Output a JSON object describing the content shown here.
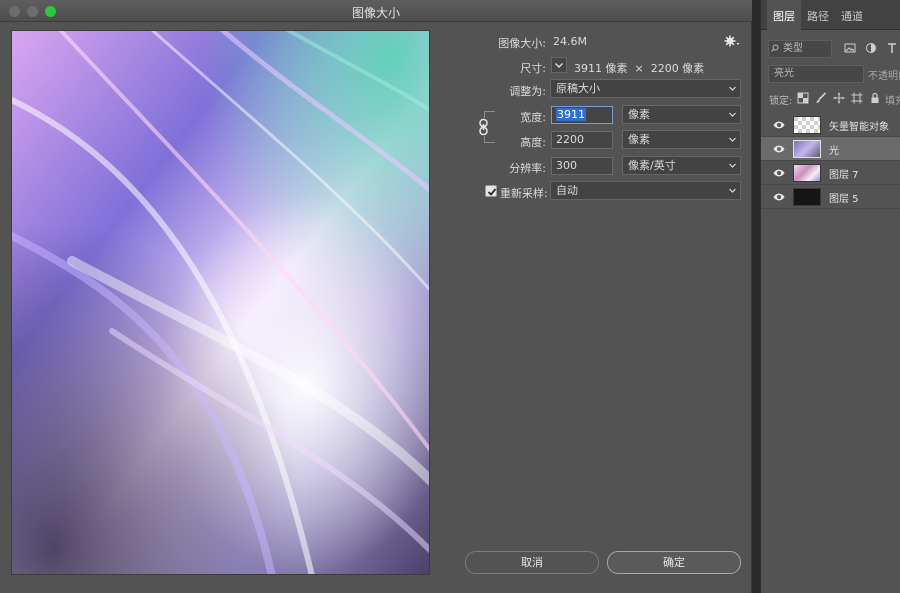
{
  "dialog": {
    "title": "图像大小",
    "image_size_label": "图像大小:",
    "image_size_value": "24.6M",
    "dimensions_label": "尺寸:",
    "dimensions_value": "3911 像素  ×  2200 像素",
    "fit_to_label": "调整为:",
    "fit_to_value": "原稿大小",
    "width_label": "宽度:",
    "width_value": "3911",
    "width_unit": "像素",
    "height_label": "高度:",
    "height_value": "2200",
    "height_unit": "像素",
    "resolution_label": "分辨率:",
    "resolution_value": "300",
    "resolution_unit": "像素/英寸",
    "resample_label": "重新采样:",
    "resample_checked": true,
    "resample_value": "自动",
    "cancel_label": "取消",
    "ok_label": "确定",
    "icons": [
      "gear-icon",
      "chain-link-icon",
      "checkmark-icon",
      "chevron-down-icon"
    ]
  },
  "layers_panel": {
    "tabs": [
      "图层",
      "路径",
      "通道"
    ],
    "active_tab": "图层",
    "kind_filter": "类型",
    "blend_mode": "亮光",
    "opacity_label": "不透明度",
    "lock_label": "锁定:",
    "fill_label": "填充",
    "layers": [
      {
        "name": "矢量智能对象",
        "visible": true,
        "selected": false
      },
      {
        "name": "光",
        "visible": true,
        "selected": true
      },
      {
        "name": "图层 7",
        "visible": true,
        "selected": false
      },
      {
        "name": "图层 5",
        "visible": true,
        "selected": false
      }
    ]
  },
  "colors": {
    "dialog_bg": "#535353",
    "accent_selection": "#2f6fd0",
    "traffic_green": "#2bc840"
  }
}
